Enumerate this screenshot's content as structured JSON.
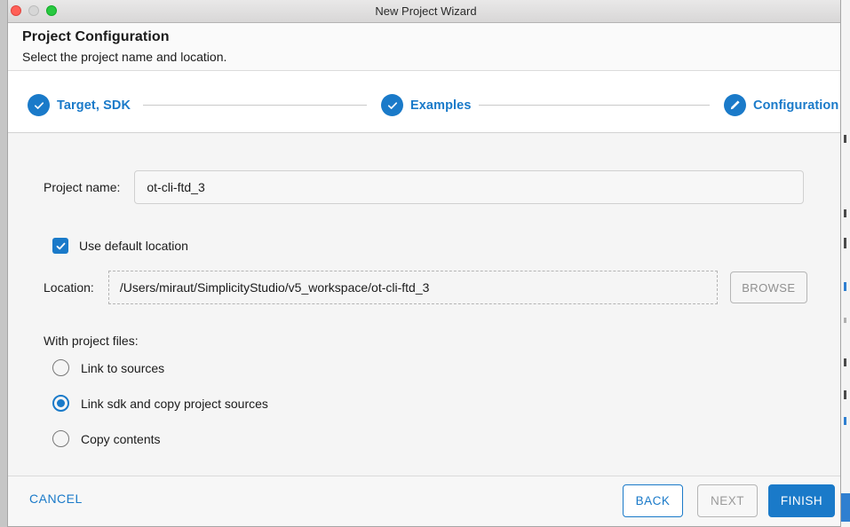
{
  "window": {
    "title": "New Project Wizard",
    "traffic_lights": [
      "close-button",
      "minimize-button",
      "zoom-button"
    ]
  },
  "header": {
    "title": "Project Configuration",
    "subtitle": "Select the project name and location."
  },
  "stepper": {
    "accent_color": "#1a7ac9",
    "steps": [
      {
        "label": "Target, SDK",
        "icon": "check-icon",
        "state": "complete"
      },
      {
        "label": "Examples",
        "icon": "check-icon",
        "state": "complete"
      },
      {
        "label": "Configuration",
        "icon": "pencil-icon",
        "state": "current"
      }
    ]
  },
  "form": {
    "project_name": {
      "label": "Project name:",
      "value": "ot-cli-ftd_3",
      "placeholder": "Project name"
    },
    "use_default_location": {
      "label": "Use default location",
      "checked": true
    },
    "location": {
      "label": "Location:",
      "value": "/Users/miraut/SimplicityStudio/v5_workspace/ot-cli-ftd_3",
      "placeholder": "Location",
      "enabled": false
    },
    "browse_button": {
      "label": "BROWSE",
      "enabled": false
    },
    "project_files": {
      "title": "With project files:",
      "options": [
        {
          "label": "Link to sources",
          "selected": false
        },
        {
          "label": "Link sdk and copy project sources",
          "selected": true
        },
        {
          "label": "Copy contents",
          "selected": false
        }
      ]
    }
  },
  "footer": {
    "cancel": "CANCEL",
    "back": "BACK",
    "next": "NEXT",
    "finish": "FINISH"
  }
}
